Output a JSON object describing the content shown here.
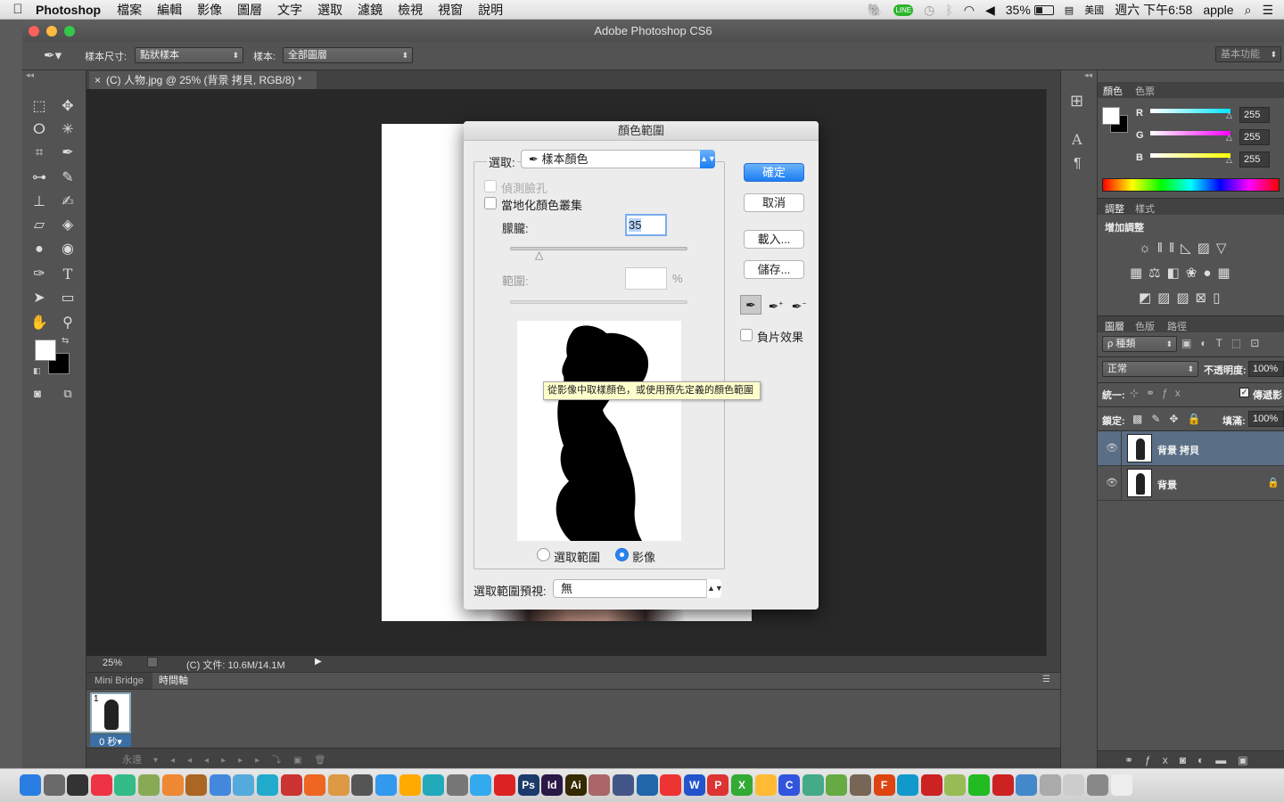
{
  "menubar": {
    "apple": "",
    "app": "Photoshop",
    "items": [
      "檔案",
      "編輯",
      "影像",
      "圖層",
      "文字",
      "選取",
      "濾鏡",
      "檢視",
      "視窗",
      "說明"
    ],
    "battery": "35%",
    "input": "美國",
    "clock": "週六 下午6:58",
    "user": "apple"
  },
  "window": {
    "title": "Adobe Photoshop CS6"
  },
  "options": {
    "sample_size_label": "樣本尺寸:",
    "sample_size_value": "點狀樣本",
    "sample_label": "樣本:",
    "sample_value": "全部圖層",
    "workspace": "基本功能"
  },
  "document": {
    "tab": "(C) 人物.jpg @ 25% (背景 拷貝, RGB/8) *",
    "close": "×"
  },
  "status": {
    "zoom": "25%",
    "doc": "(C) 文件: 10.6M/14.1M"
  },
  "timeline": {
    "tabs": [
      "Mini Bridge",
      "時間軸"
    ],
    "frame_num": "1",
    "frame_time": "0 秒▾",
    "loop": "永遠"
  },
  "color_panel": {
    "tabs": [
      "顏色",
      "色票"
    ],
    "channels": [
      {
        "name": "R",
        "value": "255",
        "color": "#00e5ff"
      },
      {
        "name": "G",
        "value": "255",
        "color": "#ff00ff"
      },
      {
        "name": "B",
        "value": "255",
        "color": "#ffff00"
      }
    ]
  },
  "adjust_panel": {
    "tabs": [
      "調整",
      "樣式"
    ],
    "heading": "增加調整"
  },
  "layers_panel": {
    "tabs": [
      "圖層",
      "色版",
      "路徑"
    ],
    "filter": "ρ 種類",
    "blend": "正常",
    "opacity_label": "不透明度:",
    "opacity": "100%",
    "unify_label": "統一:",
    "propagate": "傳遞影",
    "lock_label": "鎖定:",
    "fill_label": "填滿:",
    "fill": "100%",
    "layers": [
      {
        "name": "背景 拷貝",
        "selected": true
      },
      {
        "name": "背景",
        "selected": false
      }
    ]
  },
  "dialog": {
    "title": "顏色範圍",
    "select_label": "選取:",
    "select_value": "樣本顏色",
    "detect_faces": "偵測臉孔",
    "localized": "當地化顏色叢集",
    "fuzziness_label": "朦朧:",
    "fuzziness": "35",
    "range_label": "範圍:",
    "range_unit": "%",
    "ok": "確定",
    "cancel": "取消",
    "load": "載入...",
    "save": "儲存...",
    "invert": "負片效果",
    "radio_selection": "選取範圍",
    "radio_image": "影像",
    "preview_label": "選取範圍預視:",
    "preview_value": "無",
    "tooltip": "從影像中取樣顏色，或使用預先定義的顏色範圍"
  }
}
